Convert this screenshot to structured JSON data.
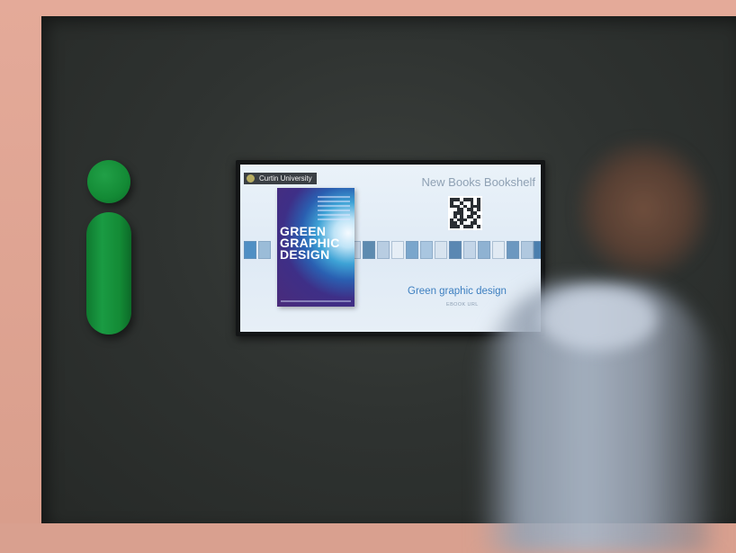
{
  "display": {
    "brand": "Curtin University",
    "shelf_title": "New Books Bookshelf",
    "cover_title": "GREEN\nGRAPHIC\nDESIGN",
    "book_title": "Green graphic design",
    "book_subtitle": "EBOOK URL"
  },
  "colors": {
    "wall": "#2f3331",
    "frame": "#d99e8c",
    "sign_green": "#138a35",
    "screen_bg": "#e4eef7",
    "title_blue": "#3d7fc0"
  },
  "icons": {
    "info_sign": "info-i-icon",
    "brand": "university-crest-icon",
    "qr": "qr-code-icon"
  }
}
